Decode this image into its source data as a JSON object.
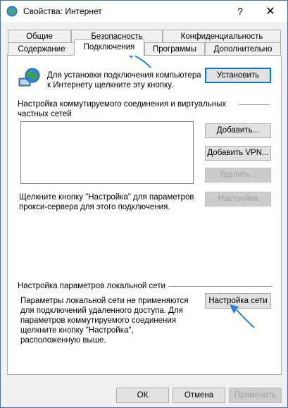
{
  "window": {
    "title": "Свойства: Интернет",
    "help_glyph": "?",
    "close_glyph": "✕"
  },
  "tabs": {
    "row1": [
      "Общие",
      "Безопасность",
      "Конфиденциальность"
    ],
    "row2": [
      "Содержание",
      "Подключения",
      "Программы",
      "Дополнительно"
    ],
    "active": "Подключения"
  },
  "setup": {
    "text": "Для установки подключения компьютера к Интернету щелкните эту кнопку.",
    "button": "Установить"
  },
  "dialup": {
    "heading": "Настройка коммутируемого соединения и виртуальных частных сетей",
    "add_button": "Добавить...",
    "add_vpn_button": "Добавить VPN...",
    "remove_button": "Удалить...",
    "settings_button": "Настройка",
    "proxy_text": "Щелкните кнопку \"Настройка\" для параметров прокси-сервера для этого подключения."
  },
  "lan": {
    "heading": "Настройка параметров локальной сети",
    "text": "Параметры локальной сети не применяются для подключений удаленного доступа. Для параметров коммутируемого соединения щелкните кнопку \"Настройка\", расположенную выше.",
    "button": "Настройка сети"
  },
  "footer": {
    "ok": "ОК",
    "cancel": "Отмена",
    "apply": "Применить"
  },
  "colors": {
    "annotation_arrow": "#2b7fd6",
    "default_button_border": "#0078d7"
  }
}
